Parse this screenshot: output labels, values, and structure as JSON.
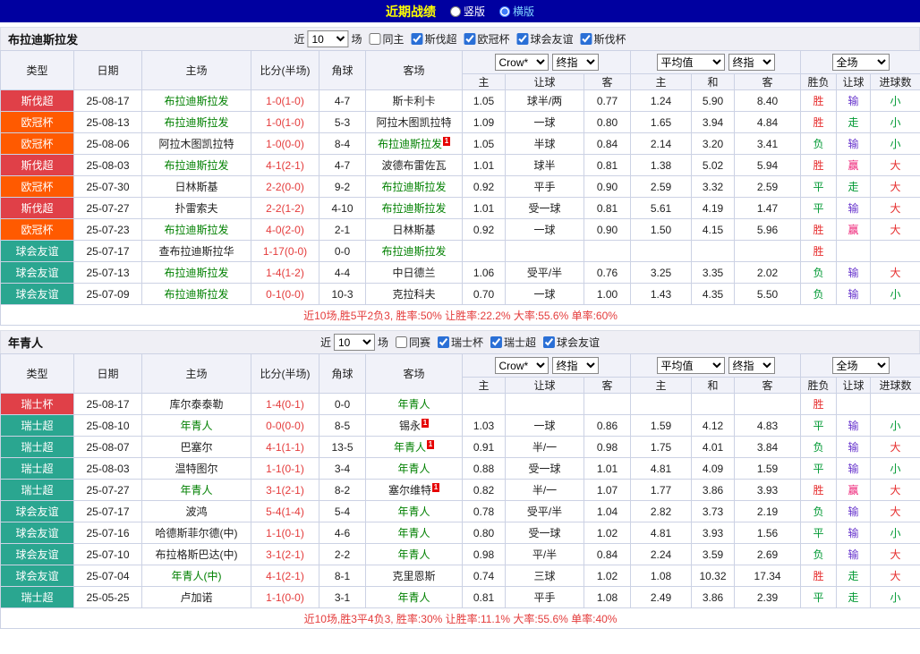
{
  "topbar": {
    "title": "近期战绩",
    "vertical_label": "竖版",
    "horizontal_label": "横版",
    "selected": "横版"
  },
  "colors": {
    "topbar-bg": "#0000a0",
    "title-yellow": "#ffff00",
    "horizontal-label-blue": "#7fd4ff",
    "badge-red": "#e04048",
    "badge-orange": "#ff5a00",
    "badge-teal": "#2aa690",
    "focus-green": "#008000",
    "score-red": "#e43b3b",
    "res-red": "#e62e2e",
    "res-green": "#009933",
    "res-purple": "#6633cc",
    "res-pink": "#ee2277",
    "summary-red": "#e43b3b",
    "header-bg": "#f1f2f9",
    "band-bg": "#efeff5",
    "border": "#ccd2e4"
  },
  "table_header": {
    "static": [
      "类型",
      "日期",
      "主场",
      "比分(半场)",
      "角球",
      "客场"
    ],
    "selects": {
      "odds_company": "Crow*",
      "odds_stage": "终指",
      "euro_company": "平均值",
      "euro_stage": "终指",
      "scope": "全场"
    },
    "sub": [
      "主",
      "让球",
      "客",
      "主",
      "和",
      "客",
      "胜负",
      "让球",
      "进球数"
    ]
  },
  "sections": [
    {
      "team": "布拉迪斯拉发",
      "filter": {
        "prefix": "近",
        "count": "10",
        "suffix": "场",
        "same": {
          "label": "同主",
          "checked": false
        },
        "leagues": [
          {
            "label": "斯伐超",
            "checked": true
          },
          {
            "label": "欧冠杯",
            "checked": true
          },
          {
            "label": "球会友谊",
            "checked": true
          },
          {
            "label": "斯伐杯",
            "checked": true
          }
        ]
      },
      "rows": [
        {
          "league": "斯伐超",
          "lc": "red",
          "date": "25-08-17",
          "home": {
            "name": "布拉迪斯拉发",
            "focus": true
          },
          "score": "1-0(1-0)",
          "corner": "4-7",
          "away": {
            "name": "斯卡利卡"
          },
          "ah": [
            "1.05",
            "球半/两",
            "0.77"
          ],
          "eu": [
            "1.24",
            "5.90",
            "8.40"
          ],
          "res": [
            "胜",
            "输",
            "小"
          ],
          "resc": [
            "red",
            "purple",
            "green"
          ]
        },
        {
          "league": "欧冠杯",
          "lc": "orange",
          "date": "25-08-13",
          "home": {
            "name": "布拉迪斯拉发",
            "focus": true
          },
          "score": "1-0(1-0)",
          "corner": "5-3",
          "away": {
            "name": "阿拉木图凯拉特"
          },
          "ah": [
            "1.09",
            "一球",
            "0.80"
          ],
          "eu": [
            "1.65",
            "3.94",
            "4.84"
          ],
          "res": [
            "胜",
            "走",
            "小"
          ],
          "resc": [
            "red",
            "green",
            "green"
          ]
        },
        {
          "league": "欧冠杯",
          "lc": "orange",
          "date": "25-08-06",
          "home": {
            "name": "阿拉木图凯拉特"
          },
          "score": "1-0(0-0)",
          "corner": "8-4",
          "away": {
            "name": "布拉迪斯拉发",
            "focus": true,
            "card": true
          },
          "ah": [
            "1.05",
            "半球",
            "0.84"
          ],
          "eu": [
            "2.14",
            "3.20",
            "3.41"
          ],
          "res": [
            "负",
            "输",
            "小"
          ],
          "resc": [
            "green",
            "purple",
            "green"
          ]
        },
        {
          "league": "斯伐超",
          "lc": "red",
          "date": "25-08-03",
          "home": {
            "name": "布拉迪斯拉发",
            "focus": true
          },
          "score": "4-1(2-1)",
          "corner": "4-7",
          "away": {
            "name": "波德布雷佐瓦"
          },
          "ah": [
            "1.01",
            "球半",
            "0.81"
          ],
          "eu": [
            "1.38",
            "5.02",
            "5.94"
          ],
          "res": [
            "胜",
            "赢",
            "大"
          ],
          "resc": [
            "red",
            "pink",
            "red"
          ]
        },
        {
          "league": "欧冠杯",
          "lc": "orange",
          "date": "25-07-30",
          "home": {
            "name": "日林斯基"
          },
          "score": "2-2(0-0)",
          "corner": "9-2",
          "away": {
            "name": "布拉迪斯拉发",
            "focus": true
          },
          "ah": [
            "0.92",
            "平手",
            "0.90"
          ],
          "eu": [
            "2.59",
            "3.32",
            "2.59"
          ],
          "res": [
            "平",
            "走",
            "大"
          ],
          "resc": [
            "green",
            "green",
            "red"
          ]
        },
        {
          "league": "斯伐超",
          "lc": "red",
          "date": "25-07-27",
          "home": {
            "name": "扑雷索夫"
          },
          "score": "2-2(1-2)",
          "corner": "4-10",
          "away": {
            "name": "布拉迪斯拉发",
            "focus": true
          },
          "ah": [
            "1.01",
            "受一球",
            "0.81"
          ],
          "eu": [
            "5.61",
            "4.19",
            "1.47"
          ],
          "res": [
            "平",
            "输",
            "大"
          ],
          "resc": [
            "green",
            "purple",
            "red"
          ]
        },
        {
          "league": "欧冠杯",
          "lc": "orange",
          "date": "25-07-23",
          "home": {
            "name": "布拉迪斯拉发",
            "focus": true
          },
          "score": "4-0(2-0)",
          "corner": "2-1",
          "away": {
            "name": "日林斯基"
          },
          "ah": [
            "0.92",
            "一球",
            "0.90"
          ],
          "eu": [
            "1.50",
            "4.15",
            "5.96"
          ],
          "res": [
            "胜",
            "赢",
            "大"
          ],
          "resc": [
            "red",
            "pink",
            "red"
          ]
        },
        {
          "league": "球会友谊",
          "lc": "teal",
          "date": "25-07-17",
          "home": {
            "name": "查布拉迪斯拉华"
          },
          "score": "1-17(0-0)",
          "corner": "0-0",
          "away": {
            "name": "布拉迪斯拉发",
            "focus": true
          },
          "ah": [
            "",
            "",
            ""
          ],
          "eu": [
            "",
            "",
            ""
          ],
          "res": [
            "胜",
            "",
            ""
          ],
          "resc": [
            "red",
            "",
            ""
          ]
        },
        {
          "league": "球会友谊",
          "lc": "teal",
          "date": "25-07-13",
          "home": {
            "name": "布拉迪斯拉发",
            "focus": true
          },
          "score": "1-4(1-2)",
          "corner": "4-4",
          "away": {
            "name": "中日德兰"
          },
          "ah": [
            "1.06",
            "受平/半",
            "0.76"
          ],
          "eu": [
            "3.25",
            "3.35",
            "2.02"
          ],
          "res": [
            "负",
            "输",
            "大"
          ],
          "resc": [
            "green",
            "purple",
            "red"
          ]
        },
        {
          "league": "球会友谊",
          "lc": "teal",
          "date": "25-07-09",
          "home": {
            "name": "布拉迪斯拉发",
            "focus": true
          },
          "score": "0-1(0-0)",
          "corner": "10-3",
          "away": {
            "name": "克拉科夫"
          },
          "ah": [
            "0.70",
            "一球",
            "1.00"
          ],
          "eu": [
            "1.43",
            "4.35",
            "5.50"
          ],
          "res": [
            "负",
            "输",
            "小"
          ],
          "resc": [
            "green",
            "purple",
            "green"
          ]
        }
      ],
      "summary": "近10场,胜5平2负3, 胜率:50% 让胜率:22.2% 大率:55.6% 单率:60%"
    },
    {
      "team": "年青人",
      "filter": {
        "prefix": "近",
        "count": "10",
        "suffix": "场",
        "same": {
          "label": "同赛",
          "checked": false
        },
        "leagues": [
          {
            "label": "瑞士杯",
            "checked": true
          },
          {
            "label": "瑞士超",
            "checked": true
          },
          {
            "label": "球会友谊",
            "checked": true
          }
        ]
      },
      "rows": [
        {
          "league": "瑞士杯",
          "lc": "red",
          "date": "25-08-17",
          "home": {
            "name": "库尔泰泰勒"
          },
          "score": "1-4(0-1)",
          "corner": "0-0",
          "away": {
            "name": "年青人",
            "focus": true
          },
          "ah": [
            "",
            "",
            ""
          ],
          "eu": [
            "",
            "",
            ""
          ],
          "res": [
            "胜",
            "",
            ""
          ],
          "resc": [
            "red",
            "",
            ""
          ]
        },
        {
          "league": "瑞士超",
          "lc": "teal",
          "date": "25-08-10",
          "home": {
            "name": "年青人",
            "focus": true
          },
          "score": "0-0(0-0)",
          "corner": "8-5",
          "away": {
            "name": "锡永",
            "card": true
          },
          "ah": [
            "1.03",
            "一球",
            "0.86"
          ],
          "eu": [
            "1.59",
            "4.12",
            "4.83"
          ],
          "res": [
            "平",
            "输",
            "小"
          ],
          "resc": [
            "green",
            "purple",
            "green"
          ]
        },
        {
          "league": "瑞士超",
          "lc": "teal",
          "date": "25-08-07",
          "home": {
            "name": "巴塞尔"
          },
          "score": "4-1(1-1)",
          "corner": "13-5",
          "away": {
            "name": "年青人",
            "focus": true,
            "card": true
          },
          "ah": [
            "0.91",
            "半/一",
            "0.98"
          ],
          "eu": [
            "1.75",
            "4.01",
            "3.84"
          ],
          "res": [
            "负",
            "输",
            "大"
          ],
          "resc": [
            "green",
            "purple",
            "red"
          ]
        },
        {
          "league": "瑞士超",
          "lc": "teal",
          "date": "25-08-03",
          "home": {
            "name": "温特图尔"
          },
          "score": "1-1(0-1)",
          "corner": "3-4",
          "away": {
            "name": "年青人",
            "focus": true
          },
          "ah": [
            "0.88",
            "受一球",
            "1.01"
          ],
          "eu": [
            "4.81",
            "4.09",
            "1.59"
          ],
          "res": [
            "平",
            "输",
            "小"
          ],
          "resc": [
            "green",
            "purple",
            "green"
          ]
        },
        {
          "league": "瑞士超",
          "lc": "teal",
          "date": "25-07-27",
          "home": {
            "name": "年青人",
            "focus": true
          },
          "score": "3-1(2-1)",
          "corner": "8-2",
          "away": {
            "name": "塞尔维特",
            "card": true
          },
          "ah": [
            "0.82",
            "半/一",
            "1.07"
          ],
          "eu": [
            "1.77",
            "3.86",
            "3.93"
          ],
          "res": [
            "胜",
            "赢",
            "大"
          ],
          "resc": [
            "red",
            "pink",
            "red"
          ]
        },
        {
          "league": "球会友谊",
          "lc": "teal",
          "date": "25-07-17",
          "home": {
            "name": "波鸿"
          },
          "score": "5-4(1-4)",
          "corner": "5-4",
          "away": {
            "name": "年青人",
            "focus": true
          },
          "ah": [
            "0.78",
            "受平/半",
            "1.04"
          ],
          "eu": [
            "2.82",
            "3.73",
            "2.19"
          ],
          "res": [
            "负",
            "输",
            "大"
          ],
          "resc": [
            "green",
            "purple",
            "red"
          ]
        },
        {
          "league": "球会友谊",
          "lc": "teal",
          "date": "25-07-16",
          "home": {
            "name": "哈德斯菲尔德(中)"
          },
          "score": "1-1(0-1)",
          "corner": "4-6",
          "away": {
            "name": "年青人",
            "focus": true
          },
          "ah": [
            "0.80",
            "受一球",
            "1.02"
          ],
          "eu": [
            "4.81",
            "3.93",
            "1.56"
          ],
          "res": [
            "平",
            "输",
            "小"
          ],
          "resc": [
            "green",
            "purple",
            "green"
          ]
        },
        {
          "league": "球会友谊",
          "lc": "teal",
          "date": "25-07-10",
          "home": {
            "name": "布拉格斯巴达(中)"
          },
          "score": "3-1(2-1)",
          "corner": "2-2",
          "away": {
            "name": "年青人",
            "focus": true
          },
          "ah": [
            "0.98",
            "平/半",
            "0.84"
          ],
          "eu": [
            "2.24",
            "3.59",
            "2.69"
          ],
          "res": [
            "负",
            "输",
            "大"
          ],
          "resc": [
            "green",
            "purple",
            "red"
          ]
        },
        {
          "league": "球会友谊",
          "lc": "teal",
          "date": "25-07-04",
          "home": {
            "name": "年青人(中)",
            "focus": true
          },
          "score": "4-1(2-1)",
          "corner": "8-1",
          "away": {
            "name": "克里恩斯"
          },
          "ah": [
            "0.74",
            "三球",
            "1.02"
          ],
          "eu": [
            "1.08",
            "10.32",
            "17.34"
          ],
          "res": [
            "胜",
            "走",
            "大"
          ],
          "resc": [
            "red",
            "green",
            "red"
          ]
        },
        {
          "league": "瑞士超",
          "lc": "teal",
          "date": "25-05-25",
          "home": {
            "name": "卢加诺"
          },
          "score": "1-1(0-0)",
          "corner": "3-1",
          "away": {
            "name": "年青人",
            "focus": true
          },
          "ah": [
            "0.81",
            "平手",
            "1.08"
          ],
          "eu": [
            "2.49",
            "3.86",
            "2.39"
          ],
          "res": [
            "平",
            "走",
            "小"
          ],
          "resc": [
            "green",
            "green",
            "green"
          ]
        }
      ],
      "summary": "近10场,胜3平4负3, 胜率:30% 让胜率:11.1% 大率:55.6% 单率:40%"
    }
  ]
}
